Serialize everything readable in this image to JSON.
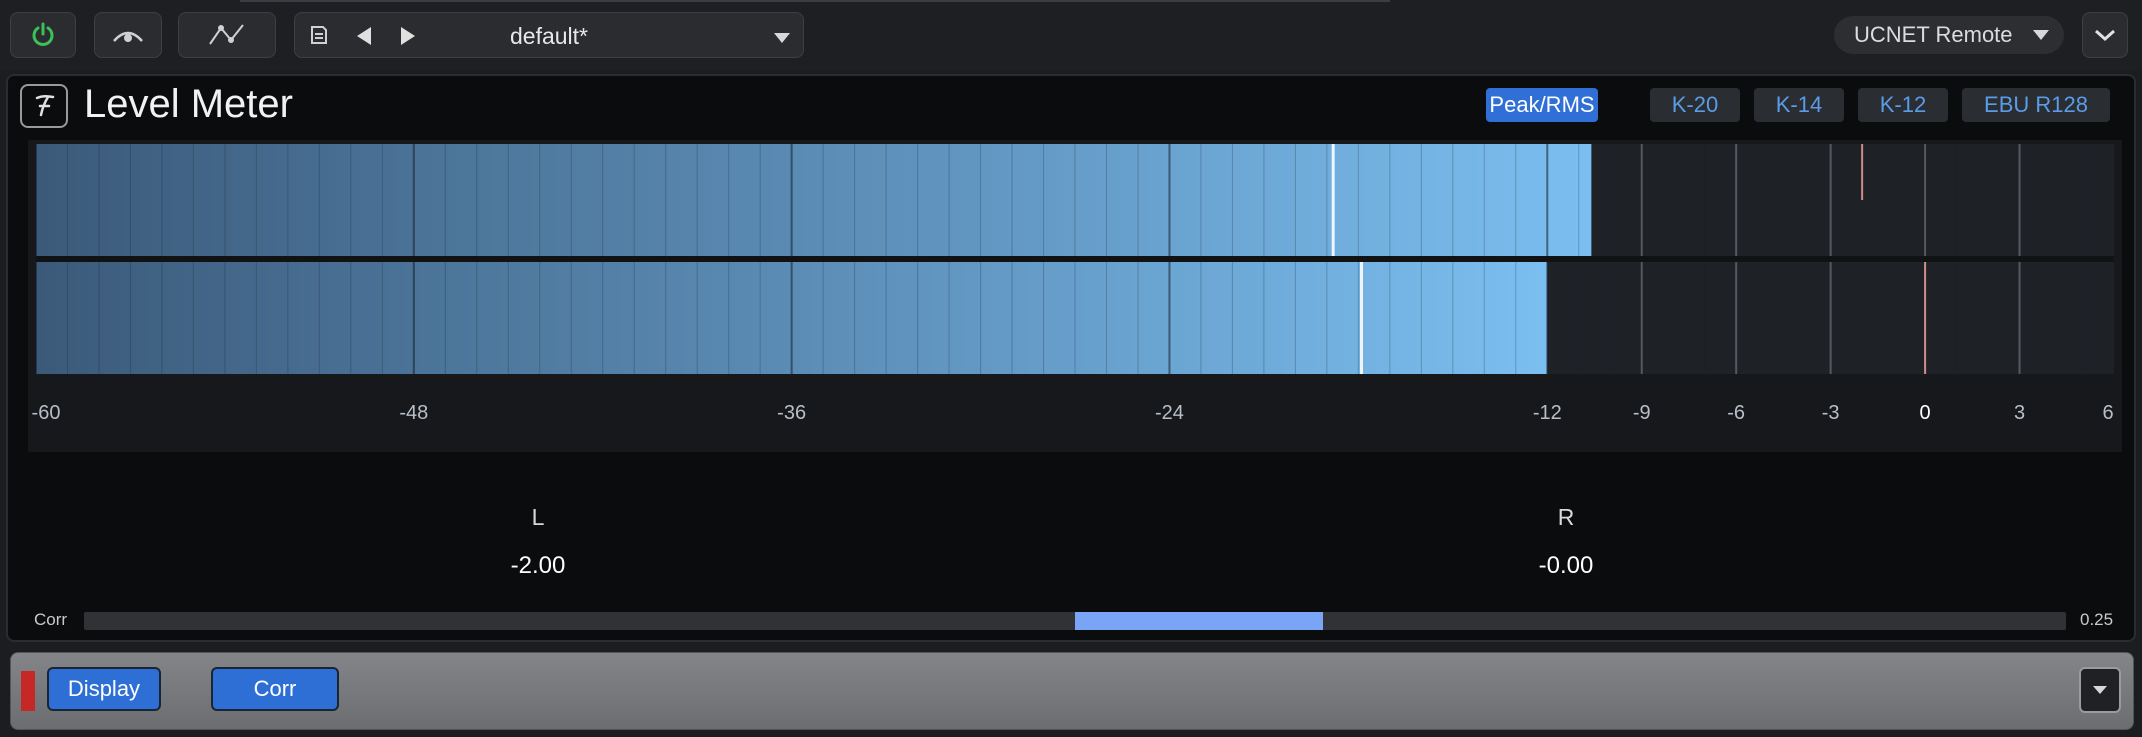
{
  "toolbar": {
    "preset_name": "default*",
    "remote_label": "UCNET Remote",
    "icons": [
      "power-icon",
      "compare-icon",
      "automation-icon",
      "save-icon",
      "previous-icon",
      "next-icon",
      "dropdown-icon",
      "expand-icon"
    ]
  },
  "plugin": {
    "title": "Level Meter",
    "modes": [
      "Peak/RMS",
      "K-20",
      "K-14",
      "K-12",
      "EBU R128"
    ],
    "active_mode": "Peak/RMS"
  },
  "meter": {
    "scale_labels": [
      "-60",
      "-48",
      "-36",
      "-24",
      "-12",
      "-9",
      "-6",
      "-3",
      "0",
      "3",
      "6"
    ],
    "range_db": [
      -60,
      6
    ],
    "channels": [
      {
        "name": "L",
        "value": "-2.00",
        "level_db": -10.6,
        "hold_db": -18.8
      },
      {
        "name": "R",
        "value": "-0.00",
        "level_db": -12.0,
        "hold_db": -17.9
      }
    ]
  },
  "correlation": {
    "label": "Corr",
    "value": "0.25",
    "fill_from": 0.0,
    "fill_to": 0.25
  },
  "bottom_bar": {
    "display_label": "Display",
    "corr_label": "Corr"
  },
  "colors": {
    "accent": "#2f6fd6",
    "meter_start": "#3b5a7a",
    "meter_end": "#7bbef0",
    "power": "#3cc05a",
    "clip_marker": "#d08a8a"
  }
}
